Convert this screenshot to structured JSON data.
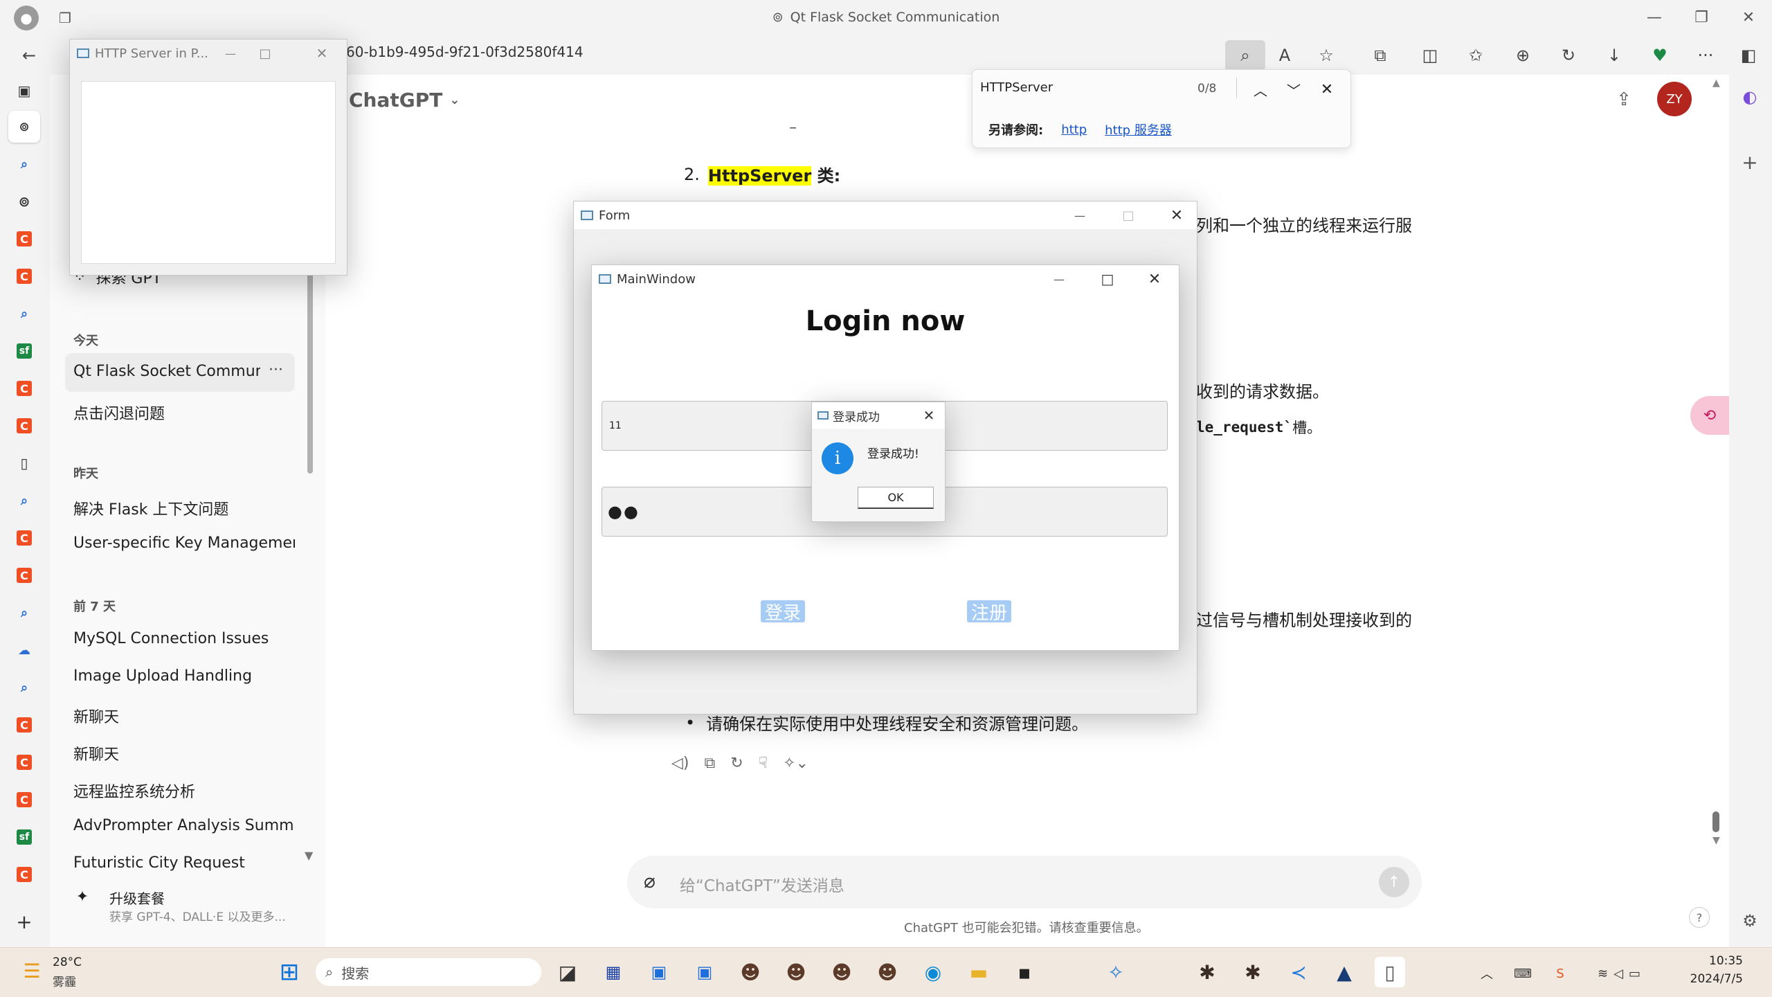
{
  "browser": {
    "title": "Qt Flask Socket Communication",
    "url": "60-b1b9-495d-9f21-0f3d2580f414"
  },
  "find": {
    "query": "HTTPServer",
    "count": "0/8",
    "see_also_label": "另请参阅:",
    "see_also_links": [
      "http",
      "http 服务器"
    ]
  },
  "gpt": {
    "model": "ChatGPT",
    "avatar": "ZY",
    "explore": "探索 GPT",
    "sections": {
      "today": "今天",
      "yesterday": "昨天",
      "week": "前 7 天"
    },
    "today_chats": [
      "Qt Flask Socket Communic",
      "点击闪退问题"
    ],
    "yesterday_chats": [
      "解决 Flask 上下文问题",
      "User-specific Key Managemen"
    ],
    "week_chats": [
      "MySQL Connection Issues",
      "Image Upload Handling",
      "新聊天",
      "新聊天",
      "远程监控系统分析",
      "AdvPrompter Analysis Summa",
      "Futuristic City Request"
    ],
    "upgrade_title": "升级套餐",
    "upgrade_sub": "获享 GPT-4、DALL·E 以及更多...",
    "composer_placeholder": "给“ChatGPT”发送消息",
    "disclaimer": "ChatGPT 也可能会犯错。请核查重要信息。",
    "content": {
      "dash": "–",
      "item_num": "2.",
      "item_highlight": "HttpServer",
      "item_suffix": " 类:",
      "frag1": "列和一个独立的线程来运行服",
      "frag2": "收到的请求数据。",
      "frag3_code": "le_request`",
      "frag3_suffix": " 槽。",
      "frag4": "过信号与槽机制处理接收到的",
      "bullet": "请确保在实际使用中处理线程安全和资源管理问题。"
    }
  },
  "windows": {
    "http_server": {
      "title": "HTTP Server in P..."
    },
    "form": {
      "title": "Form"
    },
    "main": {
      "title": "MainWindow",
      "heading": "Login now",
      "username": "11",
      "password": "●●",
      "login_btn": "登录",
      "register_btn": "注册"
    },
    "dialog": {
      "title": "登录成功",
      "message": "登录成功!",
      "ok": "OK"
    }
  },
  "taskbar": {
    "temp": "28°C",
    "weather": "雾霾",
    "search": "搜索",
    "time": "10:35",
    "date": "2024/7/5"
  },
  "colors": {
    "highlight": "#ffff00",
    "avatar_bg": "#b3261e",
    "info_icon": "#1e88e5",
    "button_blue": "#a6ccf5"
  }
}
